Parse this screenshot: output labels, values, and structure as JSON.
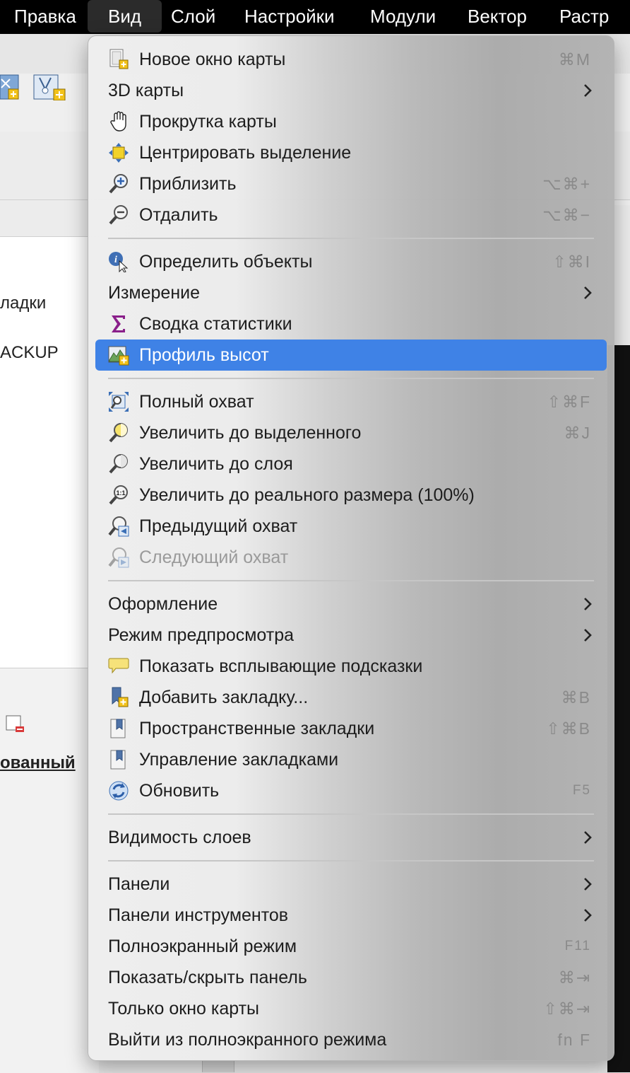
{
  "menubar": {
    "items": [
      {
        "label": "Правка"
      },
      {
        "label": "Вид"
      },
      {
        "label": "Слой"
      },
      {
        "label": "Настройки"
      },
      {
        "label": "Модули"
      },
      {
        "label": "Вектор"
      },
      {
        "label": "Растр"
      }
    ],
    "active": "Вид"
  },
  "background": {
    "text_1": "ладки",
    "text_2": "ACKUP",
    "text_3": "ованный"
  },
  "menu": {
    "group1": {
      "new_map_window": {
        "label": "Новое окно карты",
        "shortcut": "⌘M"
      },
      "maps_3d": {
        "label": "3D карты"
      },
      "pan_map": {
        "label": "Прокрутка карты"
      },
      "pan_to_selection": {
        "label": "Центрировать выделение"
      },
      "zoom_in": {
        "label": "Приблизить",
        "shortcut": "⌥⌘+"
      },
      "zoom_out": {
        "label": "Отдалить",
        "shortcut": "⌥⌘−"
      }
    },
    "group2": {
      "identify": {
        "label": "Определить объекты",
        "shortcut": "⇧⌘I"
      },
      "measure": {
        "label": "Измерение"
      },
      "stats_summary": {
        "label": "Сводка статистики"
      },
      "elevation_profile": {
        "label": "Профиль высот"
      }
    },
    "group3": {
      "zoom_full": {
        "label": "Полный охват",
        "shortcut": "⇧⌘F"
      },
      "zoom_selection": {
        "label": "Увеличить до выделенного",
        "shortcut": "⌘J"
      },
      "zoom_layer": {
        "label": "Увеличить до слоя"
      },
      "zoom_native": {
        "label": "Увеличить до реального размера (100%)"
      },
      "zoom_last": {
        "label": "Предыдущий охват"
      },
      "zoom_next": {
        "label": "Следующий охват"
      }
    },
    "group4": {
      "decorations": {
        "label": "Оформление"
      },
      "preview_mode": {
        "label": "Режим предпросмотра"
      },
      "map_tips": {
        "label": "Показать всплывающие подсказки"
      },
      "new_bookmark": {
        "label": "Добавить закладку...",
        "shortcut": "⌘B"
      },
      "spatial_bookmarks": {
        "label": "Пространственные закладки",
        "shortcut": "⇧⌘B"
      },
      "manage_bookmarks": {
        "label": "Управление закладками"
      },
      "refresh": {
        "label": "Обновить",
        "shortcut": "F5"
      }
    },
    "group5": {
      "layer_visibility": {
        "label": "Видимость слоев"
      }
    },
    "group6": {
      "panels": {
        "label": "Панели"
      },
      "toolbars": {
        "label": "Панели инструментов"
      },
      "fullscreen": {
        "label": "Полноэкранный режим",
        "shortcut": "F11"
      },
      "toggle_panels": {
        "label": "Показать/скрыть панель",
        "shortcut": "⌘⇥"
      },
      "map_only": {
        "label": "Только окно карты",
        "shortcut": "⇧⌘⇥"
      },
      "exit_fullscreen": {
        "label": "Выйти из полноэкранного режима",
        "shortcut": "fn F"
      }
    }
  },
  "colors": {
    "highlight": "#3f82e6",
    "menubar": "#000000",
    "sigma": "#8a1f8a"
  }
}
